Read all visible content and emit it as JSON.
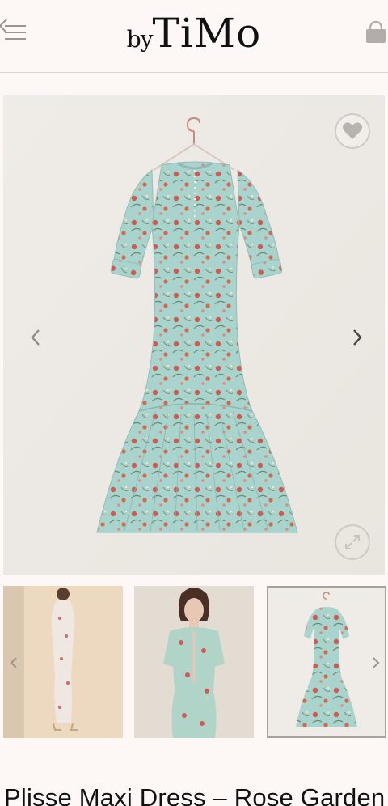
{
  "header": {
    "logo_prefix": "by",
    "logo_brand": "TiMo",
    "back_icon": "back-menu-icon",
    "bag_icon": "shopping-bag-icon"
  },
  "gallery": {
    "main_image": "floral-maxi-dress-on-hanger",
    "wishlist_icon": "heart-icon",
    "zoom_icon": "expand-icon",
    "prev_icon": "chevron-left-icon",
    "next_icon": "chevron-right-icon",
    "thumbnails": [
      {
        "name": "model-side-view"
      },
      {
        "name": "model-front-view"
      },
      {
        "name": "dress-on-hanger",
        "selected": true
      }
    ]
  },
  "product": {
    "title": "Plisse Maxi Dress – Rose Garden"
  },
  "colors": {
    "background": "#fdf7f5",
    "dress_base": "#a8d2cc",
    "floral_red": "#d0554e"
  }
}
